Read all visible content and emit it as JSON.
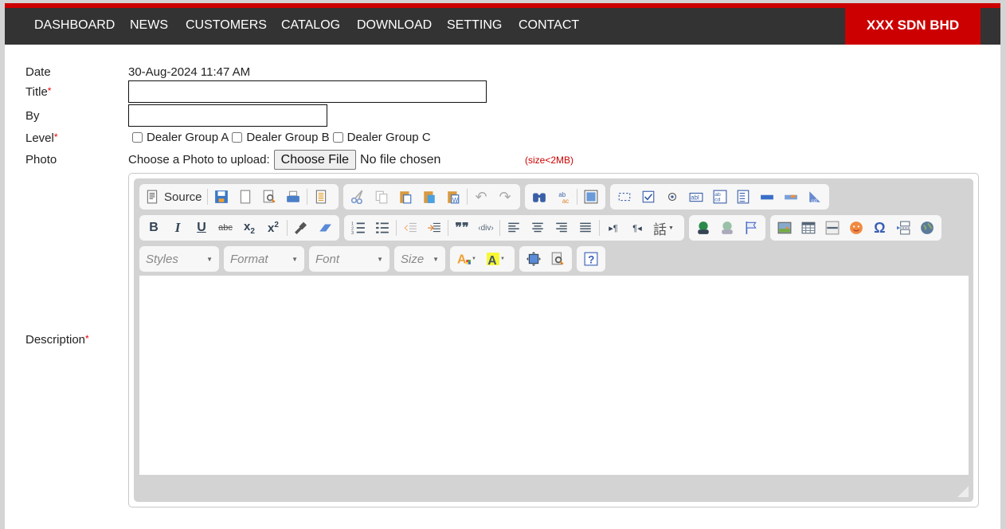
{
  "nav": {
    "items": [
      "DASHBOARD",
      "NEWS",
      "CUSTOMERS",
      "CATALOG",
      "DOWNLOAD",
      "SETTING",
      "CONTACT"
    ],
    "brand": "XXX SDN BHD",
    "colors": {
      "bar": "#333333",
      "accent": "#cc0000"
    }
  },
  "form": {
    "date_label": "Date",
    "date_value": "30-Aug-2024 11:47 AM",
    "title_label": "Title",
    "title_value": "",
    "by_label": "By",
    "by_value": "",
    "level_label": "Level",
    "required_mark": "*",
    "levels": [
      {
        "label": "Dealer Group A",
        "checked": false
      },
      {
        "label": "Dealer Group B",
        "checked": false
      },
      {
        "label": "Dealer Group C",
        "checked": false
      }
    ],
    "photo_label": "Photo",
    "photo_prompt": "Choose a Photo to upload:",
    "file_button": "Choose File",
    "file_status": "No file chosen",
    "size_note": "(size<2MB)",
    "description_label": "Description"
  },
  "editor": {
    "source_label": "Source",
    "combos": [
      "Styles",
      "Format",
      "Font",
      "Size"
    ],
    "toolbar_icons": {
      "row1": [
        "source",
        "save",
        "new-page",
        "preview",
        "print",
        "templates",
        "cut",
        "copy",
        "paste",
        "paste-text",
        "paste-word",
        "undo",
        "redo",
        "find",
        "replace",
        "select-all",
        "form",
        "checkbox",
        "radio",
        "text-field",
        "textarea",
        "select",
        "button",
        "image-button",
        "hidden-field"
      ],
      "row2": [
        "bold",
        "italic",
        "underline",
        "strike",
        "subscript",
        "superscript",
        "copy-format",
        "remove-format",
        "numbered-list",
        "bulleted-list",
        "outdent",
        "indent",
        "blockquote",
        "create-div",
        "align-left",
        "align-center",
        "align-right",
        "justify",
        "ltr",
        "rtl",
        "language",
        "link",
        "unlink",
        "anchor",
        "image",
        "table",
        "horizontal-rule",
        "smiley",
        "special-char",
        "page-break",
        "iframe"
      ],
      "row3": [
        "text-color",
        "bg-color",
        "maximize",
        "show-blocks",
        "about"
      ]
    }
  }
}
